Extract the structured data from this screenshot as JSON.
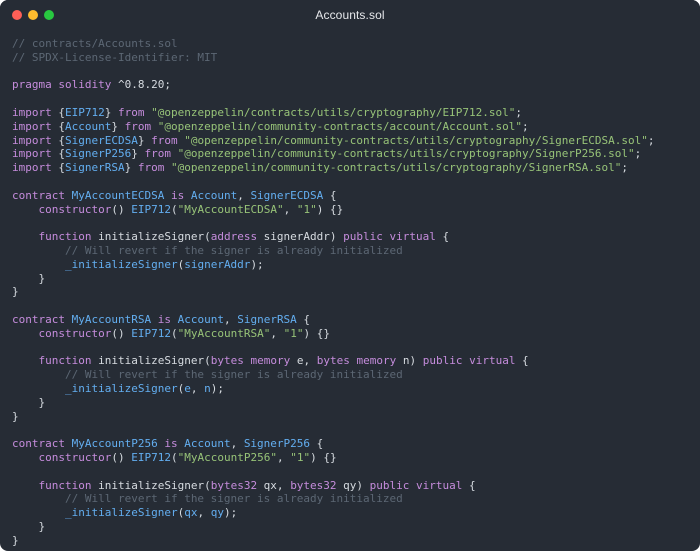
{
  "window": {
    "title": "Accounts.sol",
    "controls": [
      {
        "name": "close",
        "color": "#fe5f57"
      },
      {
        "name": "minimize",
        "color": "#febc2e"
      },
      {
        "name": "zoom",
        "color": "#28c840"
      }
    ]
  },
  "colors": {
    "background": "#262c35",
    "comment": "#5c6774",
    "keyword": "#c58cdc",
    "string": "#97c378",
    "type": "#63aef0",
    "plain": "#d6dbe0",
    "function": "#63aef0",
    "number": "#d6dbe0"
  },
  "code_lines": [
    [
      [
        "comment",
        "// contracts/Accounts.sol"
      ]
    ],
    [
      [
        "comment",
        "// SPDX-License-Identifier: MIT"
      ]
    ],
    [],
    [
      [
        "keyword",
        "pragma"
      ],
      [
        "plain",
        " "
      ],
      [
        "keyword",
        "solidity"
      ],
      [
        "plain",
        " ^0.8.20;"
      ]
    ],
    [],
    [
      [
        "keyword",
        "import"
      ],
      [
        "plain",
        " {"
      ],
      [
        "type",
        "EIP712"
      ],
      [
        "plain",
        "} "
      ],
      [
        "keyword",
        "from"
      ],
      [
        "plain",
        " "
      ],
      [
        "string",
        "\"@openzeppelin/contracts/utils/cryptography/EIP712.sol\""
      ],
      [
        "plain",
        ";"
      ]
    ],
    [
      [
        "keyword",
        "import"
      ],
      [
        "plain",
        " {"
      ],
      [
        "type",
        "Account"
      ],
      [
        "plain",
        "} "
      ],
      [
        "keyword",
        "from"
      ],
      [
        "plain",
        " "
      ],
      [
        "string",
        "\"@openzeppelin/community-contracts/account/Account.sol\""
      ],
      [
        "plain",
        ";"
      ]
    ],
    [
      [
        "keyword",
        "import"
      ],
      [
        "plain",
        " {"
      ],
      [
        "type",
        "SignerECDSA"
      ],
      [
        "plain",
        "} "
      ],
      [
        "keyword",
        "from"
      ],
      [
        "plain",
        " "
      ],
      [
        "string",
        "\"@openzeppelin/community-contracts/utils/cryptography/SignerECDSA.sol\""
      ],
      [
        "plain",
        ";"
      ]
    ],
    [
      [
        "keyword",
        "import"
      ],
      [
        "plain",
        " {"
      ],
      [
        "type",
        "SignerP256"
      ],
      [
        "plain",
        "} "
      ],
      [
        "keyword",
        "from"
      ],
      [
        "plain",
        " "
      ],
      [
        "string",
        "\"@openzeppelin/community-contracts/utils/cryptography/SignerP256.sol\""
      ],
      [
        "plain",
        ";"
      ]
    ],
    [
      [
        "keyword",
        "import"
      ],
      [
        "plain",
        " {"
      ],
      [
        "type",
        "SignerRSA"
      ],
      [
        "plain",
        "} "
      ],
      [
        "keyword",
        "from"
      ],
      [
        "plain",
        " "
      ],
      [
        "string",
        "\"@openzeppelin/community-contracts/utils/cryptography/SignerRSA.sol\""
      ],
      [
        "plain",
        ";"
      ]
    ],
    [],
    [
      [
        "keyword",
        "contract"
      ],
      [
        "plain",
        " "
      ],
      [
        "type",
        "MyAccountECDSA"
      ],
      [
        "plain",
        " "
      ],
      [
        "keyword",
        "is"
      ],
      [
        "plain",
        " "
      ],
      [
        "type",
        "Account"
      ],
      [
        "plain",
        ", "
      ],
      [
        "type",
        "SignerECDSA"
      ],
      [
        "plain",
        " {"
      ]
    ],
    [
      [
        "plain",
        "    "
      ],
      [
        "keyword",
        "constructor"
      ],
      [
        "plain",
        "() "
      ],
      [
        "type",
        "EIP712"
      ],
      [
        "plain",
        "("
      ],
      [
        "string",
        "\"MyAccountECDSA\""
      ],
      [
        "plain",
        ", "
      ],
      [
        "string",
        "\"1\""
      ],
      [
        "plain",
        ") {}"
      ]
    ],
    [],
    [
      [
        "plain",
        "    "
      ],
      [
        "keyword",
        "function"
      ],
      [
        "plain",
        " initializeSigner("
      ],
      [
        "keyword",
        "address"
      ],
      [
        "plain",
        " signerAddr) "
      ],
      [
        "keyword",
        "public"
      ],
      [
        "plain",
        " "
      ],
      [
        "keyword",
        "virtual"
      ],
      [
        "plain",
        " {"
      ]
    ],
    [
      [
        "plain",
        "        "
      ],
      [
        "comment",
        "// Will revert if the signer is already initialized"
      ]
    ],
    [
      [
        "plain",
        "        "
      ],
      [
        "function",
        "_initializeSigner"
      ],
      [
        "plain",
        "("
      ],
      [
        "function",
        "signerAddr"
      ],
      [
        "plain",
        ");"
      ]
    ],
    [
      [
        "plain",
        "    }"
      ]
    ],
    [
      [
        "plain",
        "}"
      ]
    ],
    [],
    [
      [
        "keyword",
        "contract"
      ],
      [
        "plain",
        " "
      ],
      [
        "type",
        "MyAccountRSA"
      ],
      [
        "plain",
        " "
      ],
      [
        "keyword",
        "is"
      ],
      [
        "plain",
        " "
      ],
      [
        "type",
        "Account"
      ],
      [
        "plain",
        ", "
      ],
      [
        "type",
        "SignerRSA"
      ],
      [
        "plain",
        " {"
      ]
    ],
    [
      [
        "plain",
        "    "
      ],
      [
        "keyword",
        "constructor"
      ],
      [
        "plain",
        "() "
      ],
      [
        "type",
        "EIP712"
      ],
      [
        "plain",
        "("
      ],
      [
        "string",
        "\"MyAccountRSA\""
      ],
      [
        "plain",
        ", "
      ],
      [
        "string",
        "\"1\""
      ],
      [
        "plain",
        ") {}"
      ]
    ],
    [],
    [
      [
        "plain",
        "    "
      ],
      [
        "keyword",
        "function"
      ],
      [
        "plain",
        " initializeSigner("
      ],
      [
        "keyword",
        "bytes"
      ],
      [
        "plain",
        " "
      ],
      [
        "keyword",
        "memory"
      ],
      [
        "plain",
        " e, "
      ],
      [
        "keyword",
        "bytes"
      ],
      [
        "plain",
        " "
      ],
      [
        "keyword",
        "memory"
      ],
      [
        "plain",
        " n) "
      ],
      [
        "keyword",
        "public"
      ],
      [
        "plain",
        " "
      ],
      [
        "keyword",
        "virtual"
      ],
      [
        "plain",
        " {"
      ]
    ],
    [
      [
        "plain",
        "        "
      ],
      [
        "comment",
        "// Will revert if the signer is already initialized"
      ]
    ],
    [
      [
        "plain",
        "        "
      ],
      [
        "function",
        "_initializeSigner"
      ],
      [
        "plain",
        "("
      ],
      [
        "function",
        "e"
      ],
      [
        "plain",
        ", "
      ],
      [
        "function",
        "n"
      ],
      [
        "plain",
        ");"
      ]
    ],
    [
      [
        "plain",
        "    }"
      ]
    ],
    [
      [
        "plain",
        "}"
      ]
    ],
    [],
    [
      [
        "keyword",
        "contract"
      ],
      [
        "plain",
        " "
      ],
      [
        "type",
        "MyAccountP256"
      ],
      [
        "plain",
        " "
      ],
      [
        "keyword",
        "is"
      ],
      [
        "plain",
        " "
      ],
      [
        "type",
        "Account"
      ],
      [
        "plain",
        ", "
      ],
      [
        "type",
        "SignerP256"
      ],
      [
        "plain",
        " {"
      ]
    ],
    [
      [
        "plain",
        "    "
      ],
      [
        "keyword",
        "constructor"
      ],
      [
        "plain",
        "() "
      ],
      [
        "type",
        "EIP712"
      ],
      [
        "plain",
        "("
      ],
      [
        "string",
        "\"MyAccountP256\""
      ],
      [
        "plain",
        ", "
      ],
      [
        "string",
        "\"1\""
      ],
      [
        "plain",
        ") {}"
      ]
    ],
    [],
    [
      [
        "plain",
        "    "
      ],
      [
        "keyword",
        "function"
      ],
      [
        "plain",
        " initializeSigner("
      ],
      [
        "keyword",
        "bytes32"
      ],
      [
        "plain",
        " qx, "
      ],
      [
        "keyword",
        "bytes32"
      ],
      [
        "plain",
        " qy) "
      ],
      [
        "keyword",
        "public"
      ],
      [
        "plain",
        " "
      ],
      [
        "keyword",
        "virtual"
      ],
      [
        "plain",
        " {"
      ]
    ],
    [
      [
        "plain",
        "        "
      ],
      [
        "comment",
        "// Will revert if the signer is already initialized"
      ]
    ],
    [
      [
        "plain",
        "        "
      ],
      [
        "function",
        "_initializeSigner"
      ],
      [
        "plain",
        "("
      ],
      [
        "function",
        "qx"
      ],
      [
        "plain",
        ", "
      ],
      [
        "function",
        "qy"
      ],
      [
        "plain",
        ");"
      ]
    ],
    [
      [
        "plain",
        "    }"
      ]
    ],
    [
      [
        "plain",
        "}"
      ]
    ]
  ]
}
